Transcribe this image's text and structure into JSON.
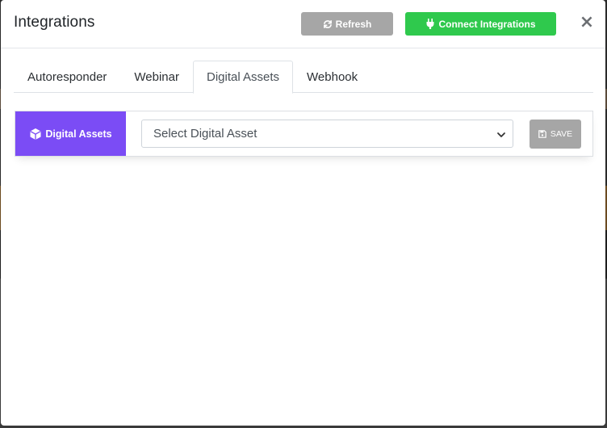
{
  "modal": {
    "title": "Integrations",
    "close_symbol": "×"
  },
  "header_buttons": {
    "refresh": {
      "label": "Refresh",
      "icon": "refresh-icon",
      "color": "#a6a6a6"
    },
    "connect": {
      "label": "Connect Integrations",
      "icon": "plug-icon",
      "color": "#2fc94d"
    }
  },
  "tabs": [
    {
      "label": "Autoresponder",
      "active": false
    },
    {
      "label": "Webinar",
      "active": false
    },
    {
      "label": "Digital Assets",
      "active": true
    },
    {
      "label": "Webhook",
      "active": false
    }
  ],
  "digital_assets_panel": {
    "label": "Digital Assets",
    "label_icon": "cube-icon",
    "accent_color": "#7b4cf5",
    "select": {
      "selected": "Select Digital Asset"
    },
    "save_button": {
      "label": "SAVE",
      "icon": "floppy-disk-icon"
    }
  }
}
